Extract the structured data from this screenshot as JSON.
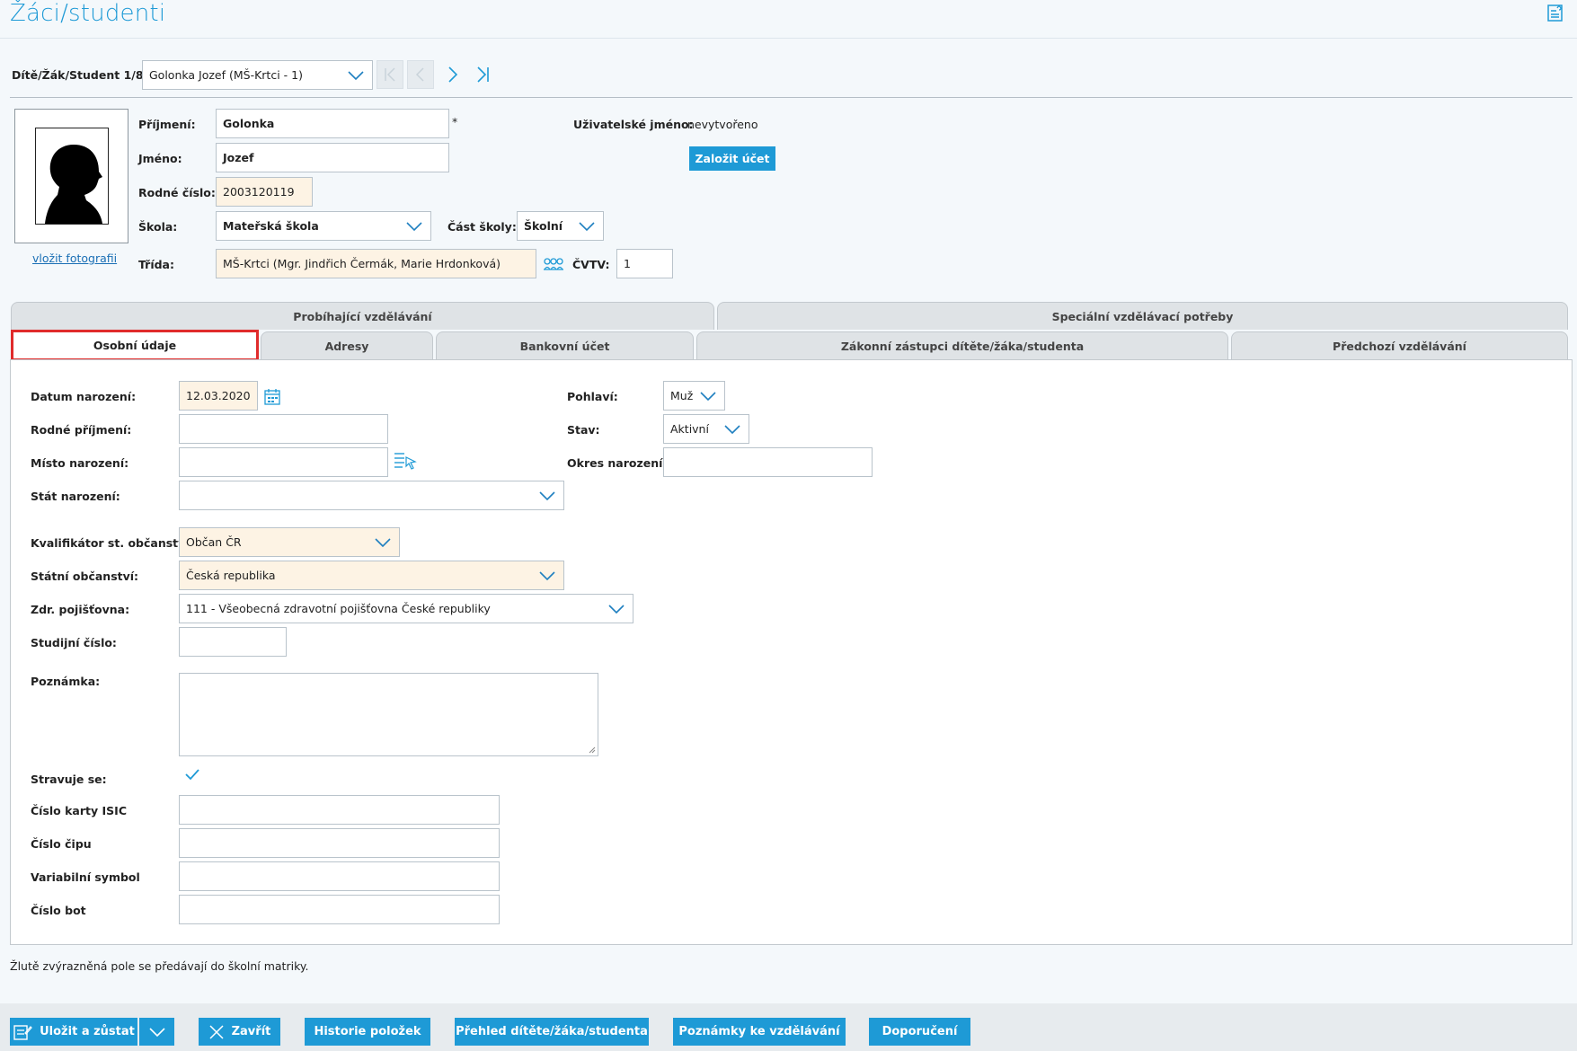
{
  "header": {
    "title": "Žáci/studenti",
    "help_icon": "manual-icon"
  },
  "navigator": {
    "label": "Dítě/Žák/Student 1/8:",
    "selected": "Golonka Jozef (MŠ-Krtci - 1)"
  },
  "photo": {
    "insert_link": "vložit fotografii"
  },
  "identity": {
    "surname_label": "Příjmení:",
    "surname": "Golonka",
    "required_mark": "*",
    "name_label": "Jméno:",
    "name": "Jozef",
    "birth_number_label": "Rodné číslo:",
    "birth_number": "2003120119",
    "school_label": "Škola:",
    "school": "Mateřská škola",
    "school_part_label": "Část školy:",
    "school_part": "Školní",
    "class_label": "Třída:",
    "class": "MŠ-Krtci (Mgr. Jindřich Čermák, Marie Hrdonková)",
    "cvtv_label": "ČVTV:",
    "cvtv": "1",
    "username_label": "Uživatelské jméno:",
    "username": "nevytvořeno",
    "create_account_button": "Založit účet"
  },
  "tabs_top": [
    {
      "label": "Probíhající vzdělávání"
    },
    {
      "label": "Speciální vzdělávací potřeby"
    }
  ],
  "tabs_bottom": [
    {
      "label": "Osobní údaje"
    },
    {
      "label": "Adresy"
    },
    {
      "label": "Bankovní účet"
    },
    {
      "label": "Zákonní zástupci dítěte/žáka/studenta"
    },
    {
      "label": "Předchozí vzdělávání"
    }
  ],
  "personal": {
    "birth_date_label": "Datum narození:",
    "birth_date": "12.03.2020",
    "maiden_name_label": "Rodné příjmení:",
    "birth_place_label": "Místo narození:",
    "birth_state_label": "Stát narození:",
    "citizenship_qualifier_label": "Kvalifikátor st. občanství:",
    "citizenship_qualifier": "Občan ČR",
    "citizenship_label": "Státní občanství:",
    "citizenship": "Česká republika",
    "insurance_label": "Zdr. pojišťovna:",
    "insurance": "111 - Všeobecná zdravotní pojišťovna České republiky",
    "study_number_label": "Studijní číslo:",
    "note_label": "Poznámka:",
    "meals_label": "Stravuje se:",
    "isic_label": "Číslo karty ISIC",
    "chip_label": "Číslo čipu",
    "variable_symbol_label": "Variabilní symbol",
    "shoe_label": "Číslo bot",
    "gender_label": "Pohlaví:",
    "gender": "Muž",
    "status_label": "Stav:",
    "status": "Aktivní",
    "birth_district_label": "Okres narození:"
  },
  "footer_note": "Žlutě zvýrazněná pole se předávají do školní matriky.",
  "toolbar": {
    "save_stay": "Uložit a zůstat",
    "close": "Zavřít",
    "history": "Historie položek",
    "overview": "Přehled dítěte/žáka/studenta",
    "notes": "Poznámky ke vzdělávání",
    "recommendations": "Doporučení"
  },
  "colors": {
    "accent": "#1e9ad6",
    "highlight_field": "#fdf3e4",
    "active_tab_border": "#e02b2b"
  }
}
